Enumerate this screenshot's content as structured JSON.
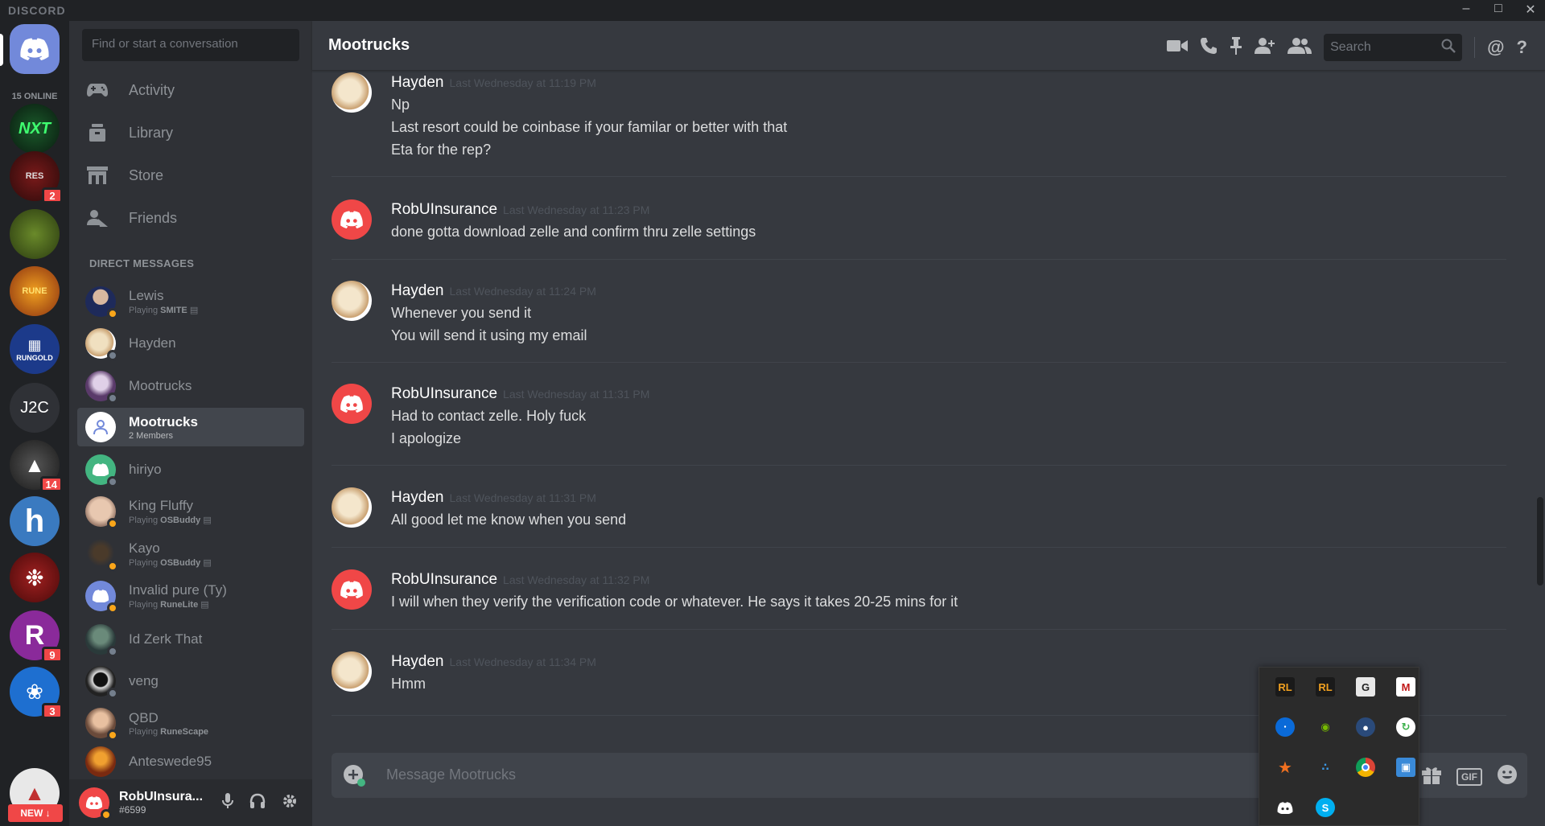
{
  "app": {
    "brand": "DISCORD",
    "online_count": "15 ONLINE",
    "new_label": "NEW"
  },
  "guilds": {
    "items": [
      {
        "name": "NEXT LVL",
        "badge": ""
      },
      {
        "name": "Resurgence",
        "badge": "2"
      },
      {
        "name": "Green server",
        "badge": ""
      },
      {
        "name": "Rune Treasure",
        "badge": ""
      },
      {
        "name": "RUNGOLD",
        "badge": ""
      },
      {
        "name": "J2C",
        "badge": ""
      },
      {
        "name": "Arrow server",
        "badge": "14"
      },
      {
        "name": "h",
        "badge": ""
      },
      {
        "name": "Red wheel",
        "badge": ""
      },
      {
        "name": "R",
        "badge": "9"
      },
      {
        "name": "Paw server",
        "badge": "3"
      },
      {
        "name": "Tree server",
        "badge": ""
      }
    ]
  },
  "sidebar": {
    "search_placeholder": "Find or start a conversation",
    "nav": [
      {
        "label": "Activity",
        "icon": "gamepad-icon"
      },
      {
        "label": "Library",
        "icon": "library-icon"
      },
      {
        "label": "Store",
        "icon": "store-icon"
      },
      {
        "label": "Friends",
        "icon": "friends-icon"
      }
    ],
    "dm_header": "DIRECT MESSAGES",
    "dms": [
      {
        "name": "Lewis",
        "activity": "Playing",
        "game": "SMITE",
        "status_color": "#faa61a"
      },
      {
        "name": "Hayden",
        "activity": "",
        "game": "",
        "status_color": "#747f8d"
      },
      {
        "name": "Mootrucks",
        "activity": "",
        "game": "",
        "status_color": "#747f8d"
      },
      {
        "name": "Mootrucks",
        "activity": "2 Members",
        "game": "",
        "status_color": ""
      },
      {
        "name": "hiriyo",
        "activity": "",
        "game": "",
        "status_color": "#747f8d"
      },
      {
        "name": "King Fluffy",
        "activity": "Playing",
        "game": "OSBuddy",
        "status_color": "#faa61a"
      },
      {
        "name": "Kayo",
        "activity": "Playing",
        "game": "OSBuddy",
        "status_color": "#faa61a"
      },
      {
        "name": "Invalid pure (Ty)",
        "activity": "Playing",
        "game": "RuneLite",
        "status_color": "#faa61a"
      },
      {
        "name": "Id Zerk That",
        "activity": "",
        "game": "",
        "status_color": "#747f8d"
      },
      {
        "name": "veng",
        "activity": "",
        "game": "",
        "status_color": "#747f8d"
      },
      {
        "name": "QBD",
        "activity": "Playing",
        "game": "RuneScape",
        "status_color": "#faa61a"
      },
      {
        "name": "Anteswede95",
        "activity": "",
        "game": "",
        "status_color": "#747f8d"
      }
    ]
  },
  "user": {
    "name": "RobUInsura...",
    "discriminator": "#6599"
  },
  "chat": {
    "title": "Mootrucks",
    "search_placeholder": "Search",
    "composer_placeholder": "Message Mootrucks",
    "gif_label": "GIF",
    "messages": [
      {
        "author": "Hayden",
        "time": "Last Wednesday at 11:19 PM",
        "lines": [
          "Np",
          "Last resort could be coinbase if your familar or better with that",
          "Eta for the rep?"
        ]
      },
      {
        "author": "RobUInsurance",
        "time": "Last Wednesday at 11:23 PM",
        "lines": [
          "done gotta download zelle and confirm thru zelle settings"
        ]
      },
      {
        "author": "Hayden",
        "time": "Last Wednesday at 11:24 PM",
        "lines": [
          "Whenever you send it",
          "You will send it using my email"
        ]
      },
      {
        "author": "RobUInsurance",
        "time": "Last Wednesday at 11:31 PM",
        "lines": [
          "Had to contact zelle. Holy fuck",
          "I apologize"
        ]
      },
      {
        "author": "Hayden",
        "time": "Last Wednesday at 11:31 PM",
        "lines": [
          "All good let me know when you send"
        ]
      },
      {
        "author": "RobUInsurance",
        "time": "Last Wednesday at 11:32 PM",
        "lines": [
          "I will when they verify the verification code or whatever. He says it takes 20-25 mins for it"
        ]
      },
      {
        "author": "Hayden",
        "time": "Last Wednesday at 11:34 PM",
        "lines": [
          "Hmm"
        ]
      }
    ]
  },
  "tray": {
    "icons": [
      "runelite-icon",
      "runelite-icon-2",
      "g-hub-icon",
      "mcafee-icon",
      "bluetooth-icon",
      "nvidia-icon",
      "steam-icon",
      "sync-icon",
      "avast-icon",
      "dots-app-icon",
      "chrome-icon",
      "monitor-app-icon",
      "discord-icon",
      "skype-icon"
    ]
  }
}
